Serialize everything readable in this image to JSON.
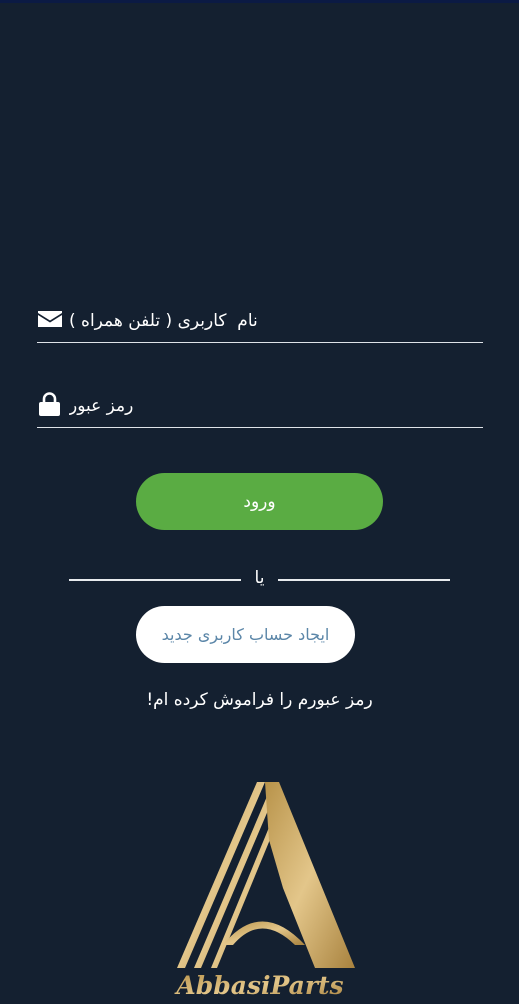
{
  "login_form": {
    "username_placeholder": "نام  کاربری ( تلفن همراه )",
    "password_placeholder": "رمز عبور",
    "login_label": "ورود"
  },
  "divider": {
    "text": "یا"
  },
  "register_label": "ایجاد حساب کاربری جدید",
  "forgot_password_label": "رمز عبورم را فراموش کرده ام!",
  "brand": {
    "logo_text": "AbbasiParts"
  },
  "icons": {
    "username": "envelope-icon",
    "password": "lock-icon"
  },
  "colors": {
    "background": "#142030",
    "login_button": "#5aac43",
    "register_text": "#5b86a8",
    "logo_gold": "#c9a65e"
  }
}
